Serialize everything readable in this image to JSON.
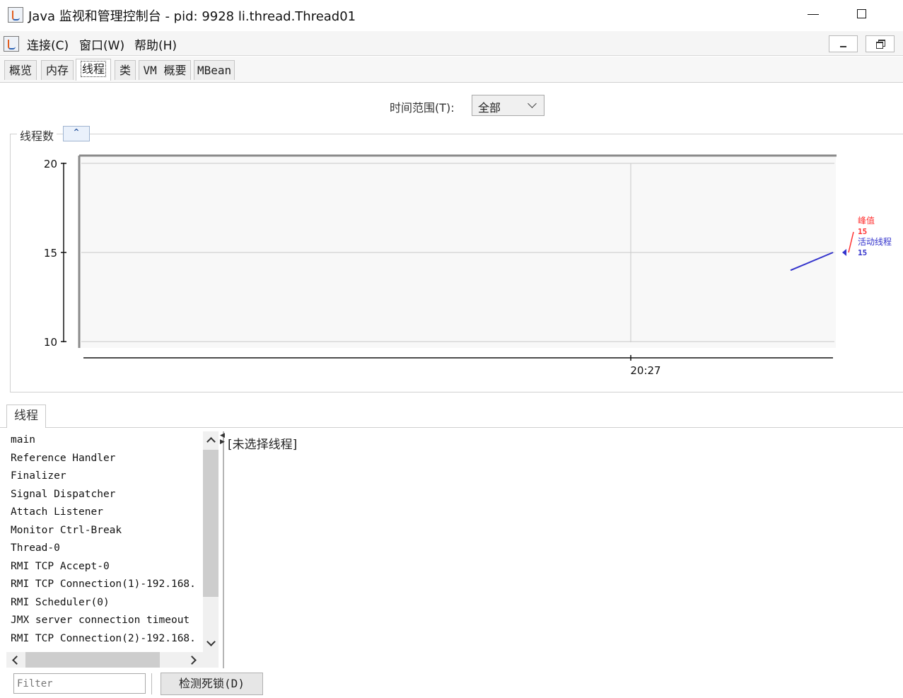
{
  "window": {
    "title": "Java 监视和管理控制台 - pid: 9928 li.thread.Thread01"
  },
  "menu": {
    "connect": "连接(C)",
    "window": "窗口(W)",
    "help": "帮助(H)"
  },
  "tabs": [
    {
      "label": "概览"
    },
    {
      "label": "内存"
    },
    {
      "label": "线程",
      "active": true
    },
    {
      "label": "类"
    },
    {
      "label": "VM 概要"
    },
    {
      "label": "MBean"
    }
  ],
  "time_range": {
    "label": "时间范围(T):",
    "value": "全部"
  },
  "chart_section": {
    "title": "线程数"
  },
  "chart_data": {
    "type": "line",
    "title": "",
    "xlabel": "",
    "ylabel": "",
    "ylim": [
      10,
      20
    ],
    "y_ticks": [
      "10",
      "15",
      "20"
    ],
    "x_ticks": [
      "20:27"
    ],
    "grid": true,
    "series": [
      {
        "name": "峰值",
        "color": "#ff3030",
        "latest": "15"
      },
      {
        "name": "活动线程",
        "color": "#3333cc",
        "latest": "15"
      }
    ],
    "visible_values": [
      14.0,
      15.0
    ]
  },
  "threads_panel": {
    "tab_label": "线程",
    "threads": [
      "main",
      "Reference Handler",
      "Finalizer",
      "Signal Dispatcher",
      "Attach Listener",
      "Monitor Ctrl-Break",
      "Thread-0",
      "RMI TCP Accept-0",
      "RMI TCP Connection(1)-192.168.",
      "RMI Scheduler(0)",
      "JMX server connection timeout",
      "RMI TCP Connection(2)-192.168."
    ],
    "detail_text": "[未选择线程]",
    "filter_placeholder": "Filter",
    "detect_deadlock": "检测死锁(D)"
  },
  "colors": {
    "peak": "#ff3030",
    "live": "#3333cc",
    "plot_bg": "#f8f8f8"
  }
}
